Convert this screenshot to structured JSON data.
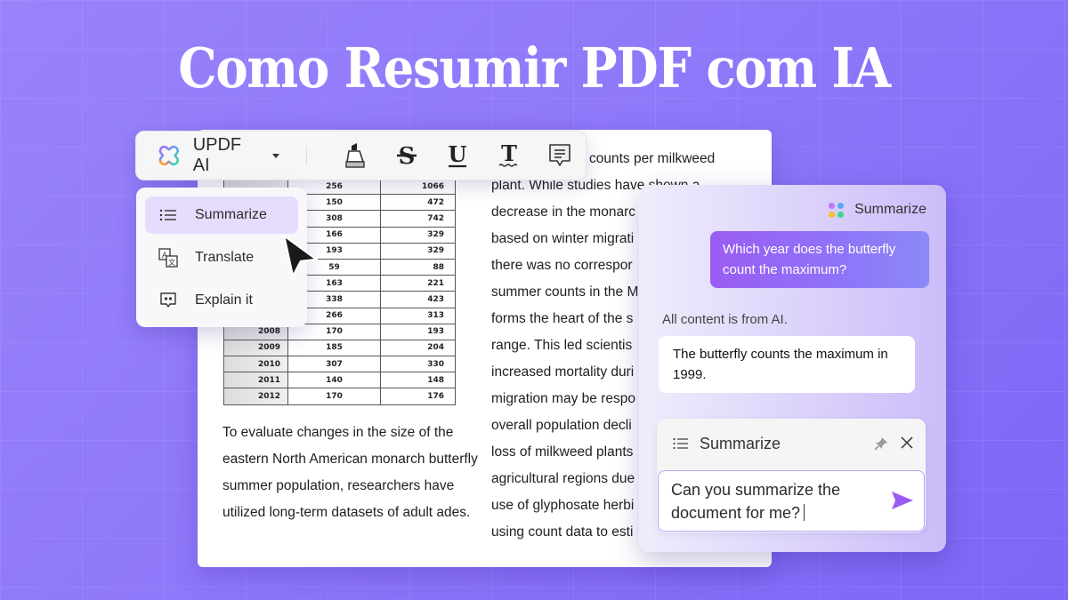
{
  "headline": "Como Resumir PDF com IA",
  "toolbar": {
    "brand_label": "UPDF AI",
    "tools": [
      {
        "name": "highlight",
        "icon": "highlighter-icon"
      },
      {
        "name": "strikethrough",
        "icon": "strikethrough-icon"
      },
      {
        "name": "underline",
        "icon": "underline-icon"
      },
      {
        "name": "squiggly",
        "icon": "squiggly-text-icon"
      },
      {
        "name": "comment",
        "icon": "comment-icon"
      }
    ]
  },
  "dropdown": {
    "items": [
      {
        "label": "Summarize",
        "icon": "list-icon",
        "active": true
      },
      {
        "label": "Translate",
        "icon": "translate-icon",
        "active": false
      },
      {
        "label": "Explain it",
        "icon": "explain-icon",
        "active": false
      }
    ]
  },
  "document": {
    "table_rows": [
      [
        "",
        "256",
        "1066"
      ],
      [
        "",
        "150",
        "472"
      ],
      [
        "",
        "308",
        "742"
      ],
      [
        "",
        "166",
        "329"
      ],
      [
        "",
        "193",
        "329"
      ],
      [
        "",
        "59",
        "88"
      ],
      [
        "",
        "163",
        "221"
      ],
      [
        "",
        "338",
        "423"
      ],
      [
        "",
        "266",
        "313"
      ],
      [
        "2008",
        "170",
        "193"
      ],
      [
        "2009",
        "185",
        "204"
      ],
      [
        "2010",
        "307",
        "330"
      ],
      [
        "2011",
        "140",
        "148"
      ],
      [
        "2012",
        "170",
        "176"
      ]
    ],
    "left_paragraph": "To evaluate changes in the size of the eastern North American monarch butterfly summer population, researchers have utilized long-term datasets of adult ades.",
    "right_lines": [
      "counts per milkweed",
      "plant. While studies have shown a",
      "decrease in the monarc",
      "based on winter migrati",
      "there was no correspor",
      "summer counts in the M",
      "forms the heart of the s",
      "range. This led scientis",
      "increased mortality duri",
      "migration may be respo",
      "overall population decli",
      "loss of milkweed plants",
      "agricultural regions due",
      "use of glyphosate herbi",
      "using count data to esti"
    ]
  },
  "ai_panel": {
    "header_label": "Summarize",
    "user_message": "Which year does the butterfly count the maximum?",
    "note": "All content is from AI.",
    "ai_answer": "The butterfly counts the maximum in 1999.",
    "prompt": {
      "mode_label": "Summarize",
      "input_value": "Can you summarize the document for me?"
    }
  },
  "colors": {
    "background": "#9080f9",
    "accent_purple": "#9b5cf3",
    "active_menu": "#e6dcfd",
    "send_icon": "#9b5cf3"
  }
}
